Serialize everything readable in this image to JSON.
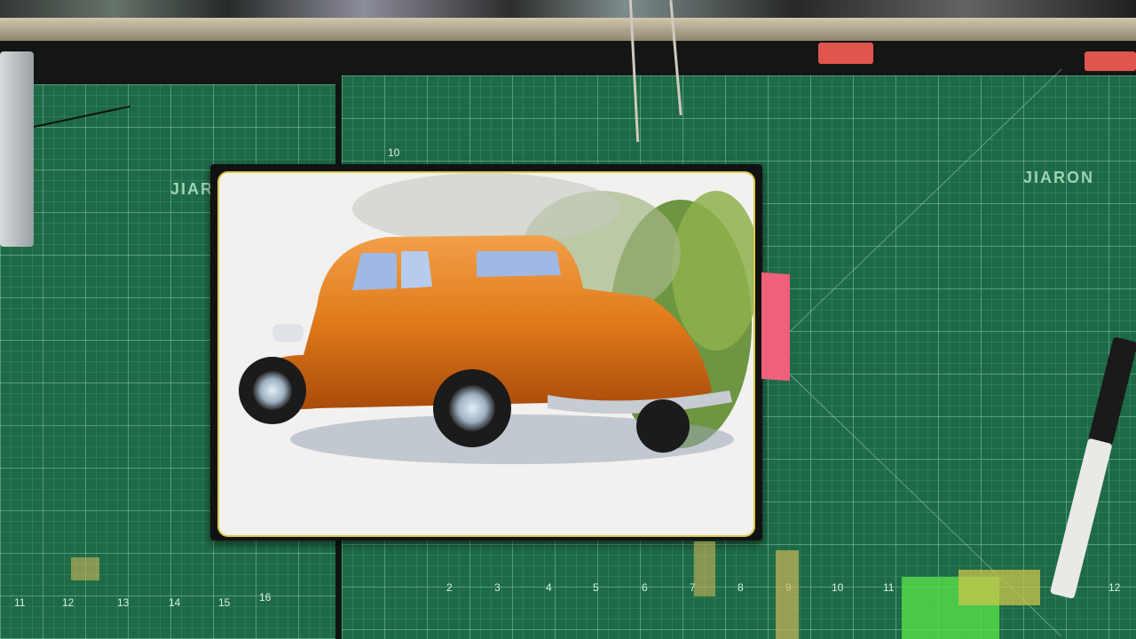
{
  "scene": {
    "mat_brand": "JIARON",
    "mat_brand_left": "JIAR",
    "top_ruler_number": "10",
    "bottom_ruler_numbers": [
      "2",
      "3",
      "4",
      "5",
      "6",
      "7",
      "8",
      "9",
      "10",
      "11",
      "12"
    ],
    "left_ruler_numbers": [
      "11",
      "12",
      "13",
      "14",
      "15",
      "16"
    ],
    "colors": {
      "mat": "#1e6a47",
      "car": "#e07a1a",
      "box_frame": "#121212",
      "tab": "#f0607a"
    }
  }
}
